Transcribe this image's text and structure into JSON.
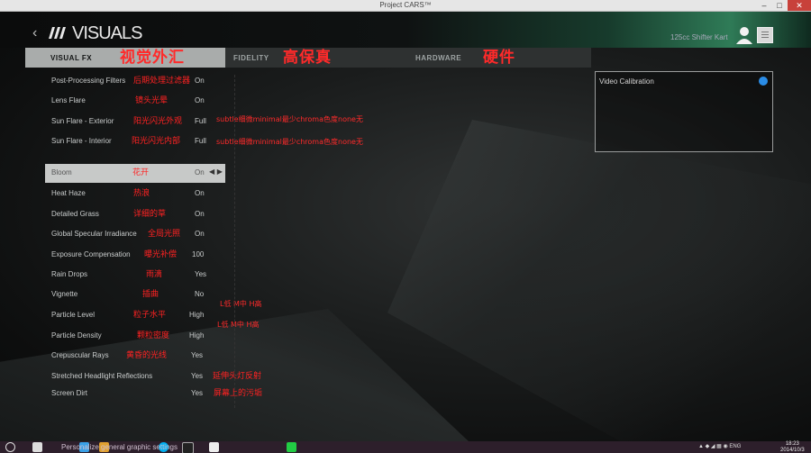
{
  "window": {
    "title": "Project CARS™",
    "controls": [
      "–",
      "□",
      "✕"
    ]
  },
  "header": {
    "back_symbol": "‹",
    "title": "VISUALS",
    "username": "125cc Shifter Kart"
  },
  "tabs": [
    {
      "label": "VISUAL FX",
      "annotation": "视觉外汇",
      "active": true
    },
    {
      "label": "FIDELITY",
      "annotation": "高保真",
      "active": false
    },
    {
      "label": "HARDWARE",
      "annotation": "硬件",
      "active": false
    }
  ],
  "settings": [
    {
      "label": "Post-Processing Filters",
      "value": "On",
      "annotation": "后期处理过滤器"
    },
    {
      "label": "Lens Flare",
      "value": "On",
      "annotation": "镜头光晕"
    },
    {
      "label": "Sun Flare - Exterior",
      "value": "Full",
      "annotation": "阳光闪光外观"
    },
    {
      "label": "Sun Flare - Interior",
      "value": "Full",
      "annotation": "阳光闪光内部"
    },
    {
      "label": "Bloom",
      "value": "On",
      "annotation": "花开",
      "selected": true
    },
    {
      "label": "Heat Haze",
      "value": "On",
      "annotation": "热浪"
    },
    {
      "label": "Detailed Grass",
      "value": "On",
      "annotation": "详细的草"
    },
    {
      "label": "Global Specular Irradiance",
      "value": "On",
      "annotation": "全局光照"
    },
    {
      "label": "Exposure Compensation",
      "value": "100",
      "annotation": "曝光补偿"
    },
    {
      "label": "Rain Drops",
      "value": "Yes",
      "annotation": "雨滴"
    },
    {
      "label": "Vignette",
      "value": "No",
      "annotation": "插曲"
    },
    {
      "label": "Particle Level",
      "value": "High",
      "annotation": "粒子水平"
    },
    {
      "label": "Particle Density",
      "value": "High",
      "annotation": "颗粒密度"
    },
    {
      "label": "Crepuscular Rays",
      "value": "Yes",
      "annotation": "黄昏的光线"
    },
    {
      "label": "Stretched Headlight Reflections",
      "value": "Yes",
      "annotation": "延伸头灯反射"
    },
    {
      "label": "Screen Dirt",
      "value": "Yes",
      "annotation": "屏幕上的污垢"
    }
  ],
  "notes": {
    "sun_flare": "subtle细微minimal最少chroma色度none无",
    "particle": "L低 M中 H高"
  },
  "side_panel": {
    "label": "Video Calibration"
  },
  "taskbar": {
    "text": "Personalize general graphic settings",
    "tray": "▲ ◆ ◢ ▦ ◉ ENG",
    "time": "18:23",
    "date": "2014/10/3"
  },
  "colors": {
    "accent_green": "#2f7b57",
    "annotation_red": "#ff2a2a",
    "calibration_dot": "#2a8ce6",
    "selected_row": "#c7c9c8"
  }
}
